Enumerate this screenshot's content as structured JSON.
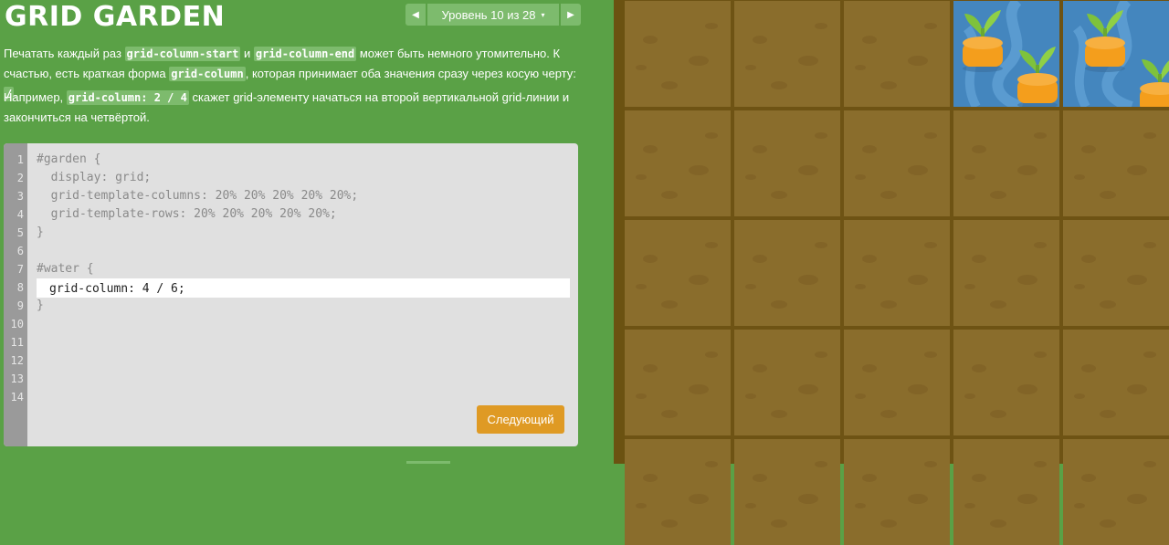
{
  "app": {
    "logo": "GRID GARDEN"
  },
  "level_nav": {
    "prev_icon": "triangle-left",
    "next_icon": "triangle-right",
    "level_text": "Уровень 10 из 28",
    "caret": "▾"
  },
  "instructions": {
    "p1": {
      "t1": "Печатать каждый раз ",
      "c1": "grid-column-start",
      "t2": " и ",
      "c2": "grid-column-end",
      "t3": " может быть немного утомительно. К счастью, есть краткая форма ",
      "c3": "grid-column",
      "t4": ", которая принимает оба значения сразу через косую черту: ",
      "c4": "/",
      "t5": "."
    },
    "p2": {
      "t1": "Например, ",
      "c1": "grid-column: 2 / 4",
      "t2": " скажет grid-элементу начаться на второй вертикальной grid-линии и закончиться на четвёртой."
    }
  },
  "editor": {
    "line_numbers": [
      "1",
      "2",
      "3",
      "4",
      "5",
      "6",
      "7",
      "8",
      "9",
      "10",
      "11",
      "12",
      "13",
      "14"
    ],
    "code_lines": [
      "#garden {",
      "  display: grid;",
      "  grid-template-columns: 20% 20% 20% 20% 20%;",
      "  grid-template-rows: 20% 20% 20% 20% 20%;",
      "}",
      "",
      "#water {",
      "",
      "}"
    ],
    "input_value": "grid-column: 4 / 6;",
    "next_button": "Следующий"
  },
  "garden": {
    "water_columns": [
      4,
      5
    ],
    "water_row": 1,
    "colors": {
      "soil": "#8a6d2c",
      "water": "#4486be",
      "grass": "#5aa146",
      "button": "#df9a24"
    }
  }
}
